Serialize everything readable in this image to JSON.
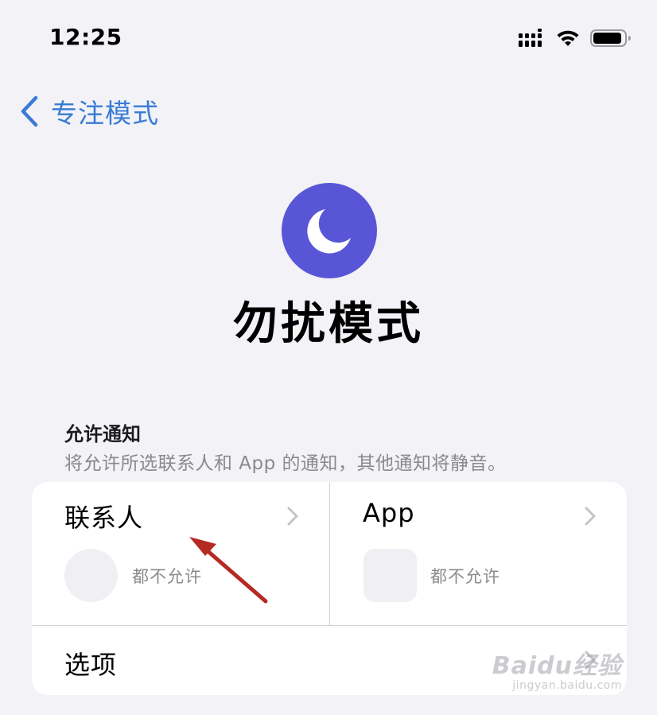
{
  "status_bar": {
    "time": "12:25"
  },
  "nav": {
    "back_label": "专注模式"
  },
  "focus": {
    "title": "勿扰模式",
    "icon_color": "#5856d6"
  },
  "allowed_notifications": {
    "header": "允许通知",
    "description": "将允许所选联系人和 App 的通知，其他通知将静音。",
    "contacts": {
      "title": "联系人",
      "status": "都不允许"
    },
    "apps": {
      "title": "App",
      "status": "都不允许"
    },
    "options": {
      "label": "选项"
    }
  },
  "watermark": {
    "main": "Baidu经验",
    "sub": "jingyan.baidu.com"
  },
  "colors": {
    "accent": "#3a7bd5",
    "annotation_arrow": "#b52a22"
  }
}
